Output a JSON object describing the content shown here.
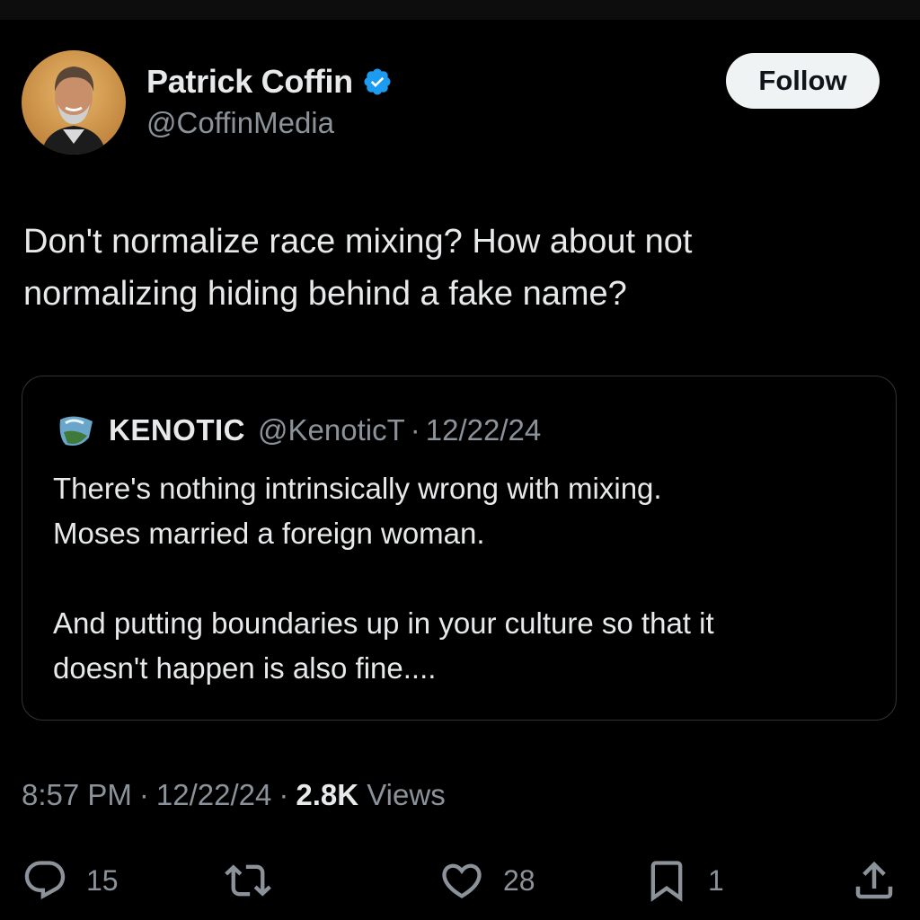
{
  "author": {
    "display_name": "Patrick Coffin",
    "handle": "@CoffinMedia",
    "verified": true,
    "verified_color": "#1d9bf0"
  },
  "follow_button": {
    "label": "Follow"
  },
  "tweet": {
    "text": "Don't normalize race mixing? How about not\nnormalizing hiding behind a fake name?"
  },
  "quoted_tweet": {
    "display_name": "KENOTIC",
    "handle": "@KenoticT",
    "separator": "·",
    "date": "12/22/24",
    "text": "There's nothing intrinsically wrong with mixing.\nMoses married a foreign woman.\n\nAnd putting boundaries up in your culture so that it\ndoesn't happen is also fine...."
  },
  "meta": {
    "time": "8:57 PM",
    "separator": "·",
    "date": "12/22/24",
    "views_count": "2.8K",
    "views_label": "Views"
  },
  "actions": {
    "reply": {
      "icon": "reply-icon",
      "count": "15"
    },
    "repost": {
      "icon": "repost-icon",
      "count": ""
    },
    "like": {
      "icon": "like-icon",
      "count": "28"
    },
    "bookmark": {
      "icon": "bookmark-icon",
      "count": "1"
    },
    "share": {
      "icon": "share-icon",
      "count": ""
    }
  },
  "colors": {
    "background": "#000000",
    "text_primary": "#e7e9ea",
    "text_secondary": "#8b9299",
    "border": "#2f3336",
    "follow_bg": "#eff3f4"
  }
}
